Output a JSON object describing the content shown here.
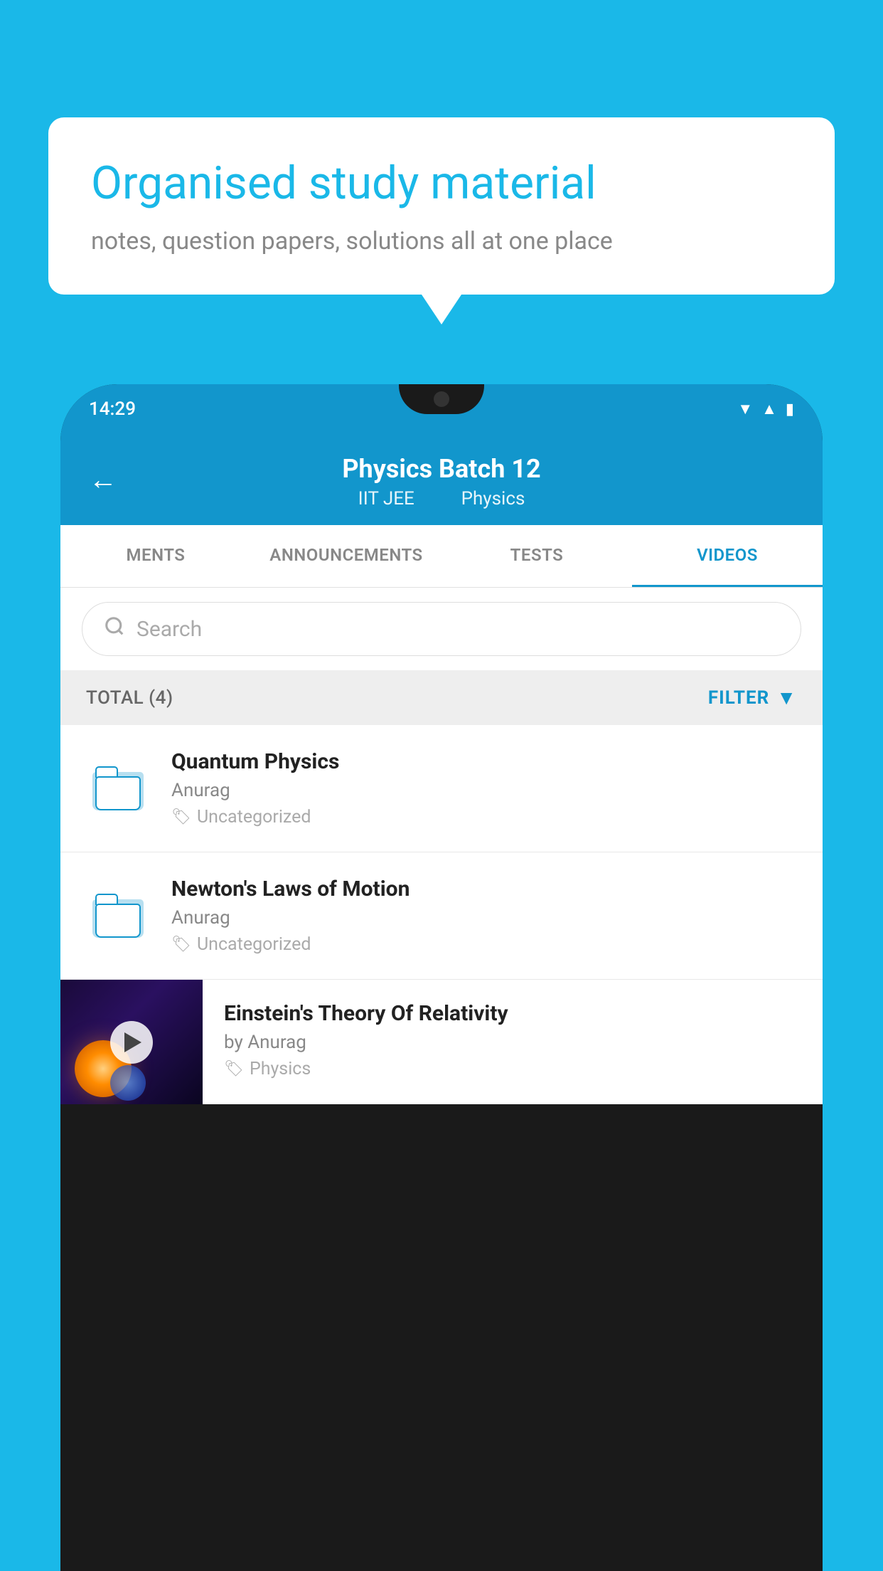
{
  "background_color": "#1ab8e8",
  "speech_bubble": {
    "title": "Organised study material",
    "subtitle": "notes, question papers, solutions all at one place"
  },
  "phone": {
    "status_bar": {
      "time": "14:29",
      "icons": [
        "wifi",
        "signal",
        "battery"
      ]
    },
    "header": {
      "title": "Physics Batch 12",
      "subtitle_part1": "IIT JEE",
      "subtitle_part2": "Physics",
      "back_arrow": "←"
    },
    "tabs": [
      {
        "label": "MENTS",
        "active": false
      },
      {
        "label": "ANNOUNCEMENTS",
        "active": false
      },
      {
        "label": "TESTS",
        "active": false
      },
      {
        "label": "VIDEOS",
        "active": true
      }
    ],
    "search": {
      "placeholder": "Search"
    },
    "filter_bar": {
      "total_label": "TOTAL (4)",
      "filter_label": "FILTER"
    },
    "videos": [
      {
        "title": "Quantum Physics",
        "author": "Anurag",
        "tag": "Uncategorized",
        "has_thumbnail": false
      },
      {
        "title": "Newton's Laws of Motion",
        "author": "Anurag",
        "tag": "Uncategorized",
        "has_thumbnail": false
      },
      {
        "title": "Einstein's Theory Of Relativity",
        "author": "by Anurag",
        "tag": "Physics",
        "has_thumbnail": true
      }
    ]
  }
}
